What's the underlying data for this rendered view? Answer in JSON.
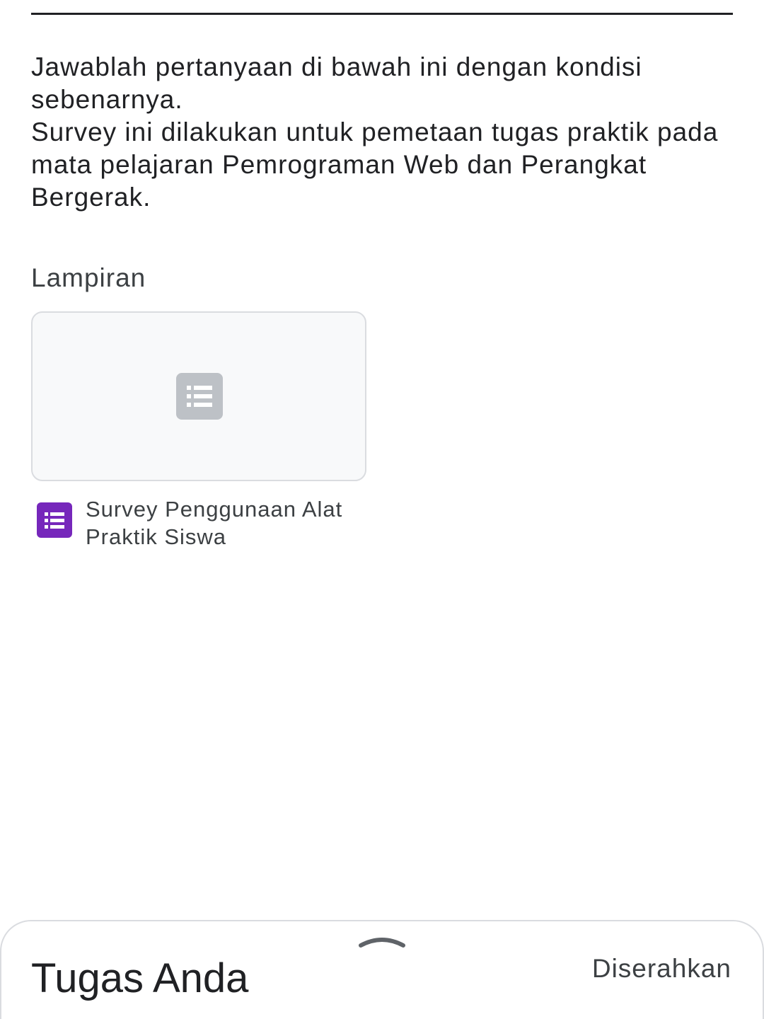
{
  "assignment": {
    "description": {
      "line1": "Jawablah pertanyaan di bawah ini dengan kondisi sebenarnya.",
      "line2": "Survey ini dilakukan untuk pemetaan tugas praktik pada mata pelajaran Pemrograman Web dan Perangkat Bergerak."
    },
    "attachments_title": "Lampiran",
    "attachments": [
      {
        "title": "Survey Penggunaan Alat Praktik Siswa",
        "icon": "forms-icon",
        "thumbnail_icon": "form-placeholder-icon"
      }
    ]
  },
  "bottom_sheet": {
    "title": "Tugas Anda",
    "status": "Diserahkan",
    "handle_icon": "chevron-up-icon"
  },
  "colors": {
    "forms_purple": "#7627bb",
    "placeholder_gray": "#bdc1c6",
    "card_background": "#f8f9fa",
    "border": "#dadce0"
  }
}
